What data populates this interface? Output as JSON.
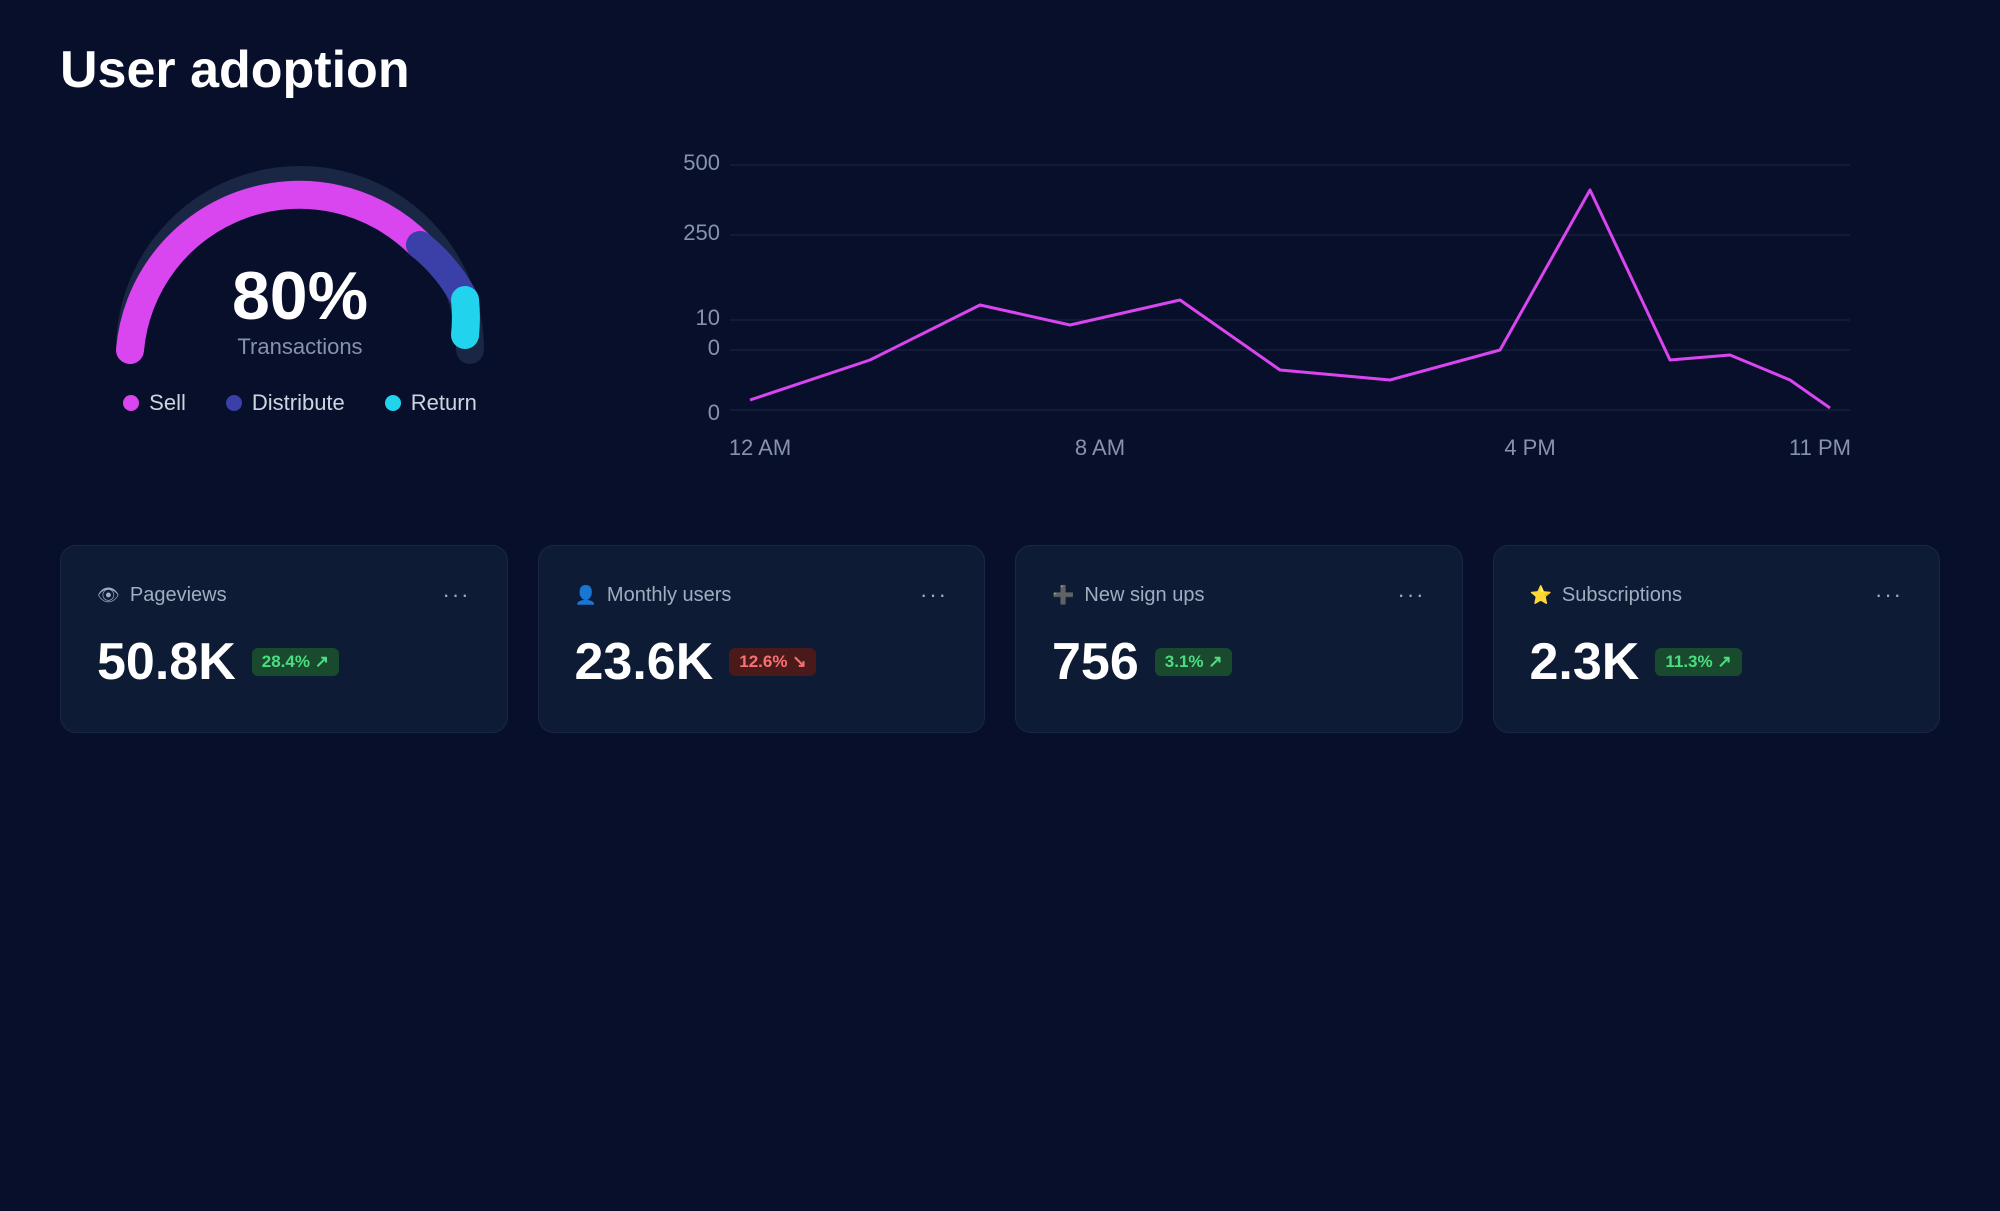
{
  "page": {
    "title": "User adoption"
  },
  "gauge": {
    "percent": "80%",
    "label": "Transactions",
    "sell_color": "#d946ef",
    "distribute_color": "#3730a3",
    "return_color": "#22d3ee"
  },
  "legend": [
    {
      "key": "sell",
      "label": "Sell",
      "color": "#d946ef"
    },
    {
      "key": "distribute",
      "label": "Distribute",
      "color": "#3730a3"
    },
    {
      "key": "return",
      "label": "Return",
      "color": "#22d3ee"
    }
  ],
  "line_chart": {
    "y_labels": [
      "500",
      "250",
      "10",
      "0",
      "0"
    ],
    "x_labels": [
      "12 AM",
      "8 AM",
      "4 PM",
      "11 PM"
    ]
  },
  "cards": [
    {
      "key": "pageviews",
      "icon": "👁",
      "title": "Pageviews",
      "value": "50.8K",
      "badge": "28.4% ↗",
      "badge_type": "green"
    },
    {
      "key": "monthly-users",
      "icon": "👤",
      "title": "Monthly users",
      "value": "23.6K",
      "badge": "12.6% ↘",
      "badge_type": "red"
    },
    {
      "key": "new-signups",
      "icon": "➕",
      "title": "New sign ups",
      "value": "756",
      "badge": "3.1% ↗",
      "badge_type": "green"
    },
    {
      "key": "subscriptions",
      "icon": "⭐",
      "title": "Subscriptions",
      "value": "2.3K",
      "badge": "11.3% ↗",
      "badge_type": "green"
    }
  ],
  "menu_label": "···"
}
